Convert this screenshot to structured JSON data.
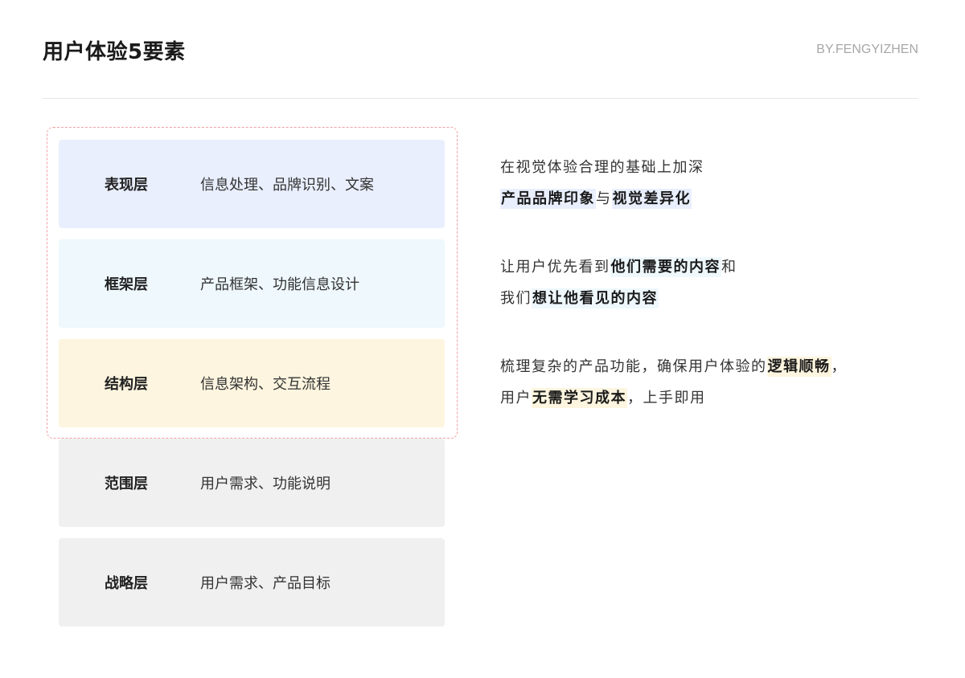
{
  "header": {
    "title": "用户体验5要素",
    "author": "BY.FENGYIZHEN"
  },
  "layers": [
    {
      "name": "表现层",
      "desc": "信息处理、品牌识别、文案"
    },
    {
      "name": "框架层",
      "desc": "产品框架、功能信息设计"
    },
    {
      "name": "结构层",
      "desc": "信息架构、交互流程"
    },
    {
      "name": "范围层",
      "desc": "用户需求、功能说明"
    },
    {
      "name": "战略层",
      "desc": "用户需求、产品目标"
    }
  ],
  "notes": [
    {
      "line1": "在视觉体验合理的基础上加深",
      "line2_h1": "产品品牌印象",
      "line2_mid": "与",
      "line2_h2": "视觉差异化"
    },
    {
      "line1_pre": "让用户优先看到",
      "line1_h": "他们需要的内容",
      "line1_post": "和",
      "line2_pre": "我们",
      "line2_h": "想让他看见的内容"
    },
    {
      "line1_pre": "梳理复杂的产品功能，确保用户体验的",
      "line1_h": "逻辑顺畅",
      "line1_post": "，",
      "line2_pre": "用户",
      "line2_h": "无需学习成本",
      "line2_post": "，上手即用"
    }
  ],
  "colors": {
    "layer_presentation": "#e9effd",
    "layer_skeleton": "#eef8fd",
    "layer_structure": "#fdf5df",
    "layer_scope": "#f0f0f0",
    "layer_strategy": "#f0f0f0",
    "dashed_frame": "#f3a1a1"
  }
}
